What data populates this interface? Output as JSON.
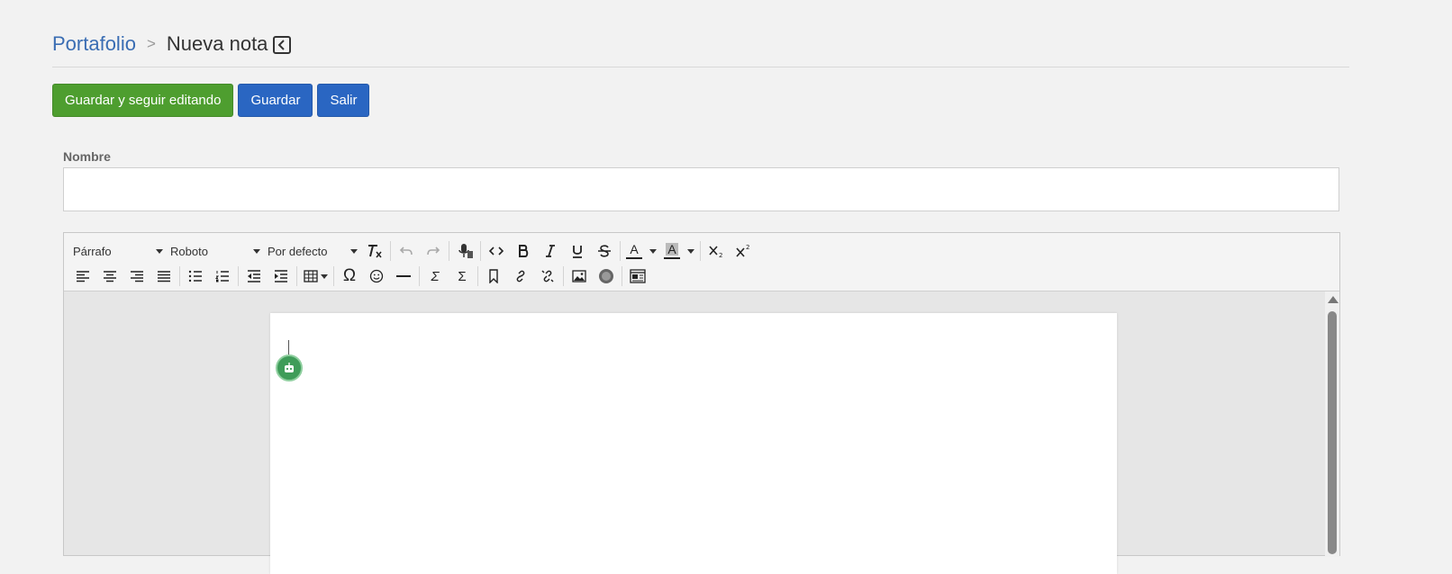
{
  "breadcrumb": {
    "parent": "Portafolio",
    "separator": ">",
    "current": "Nueva nota"
  },
  "actions": {
    "save_continue": "Guardar y seguir editando",
    "save": "Guardar",
    "exit": "Salir"
  },
  "form": {
    "name_label": "Nombre",
    "name_value": ""
  },
  "toolbar": {
    "block_format": "Párrafo",
    "font_family": "Roboto",
    "font_size": "Por defecto",
    "text_color_letter": "A",
    "bg_color_letter": "A",
    "special_char": "Ω",
    "sum_a": "Σ",
    "sum_b": "Σ"
  },
  "colors": {
    "primary_green": "#4e9e2f",
    "primary_blue": "#2a66c2",
    "link_blue": "#3a6db3",
    "bot_green": "#3f9c59"
  }
}
